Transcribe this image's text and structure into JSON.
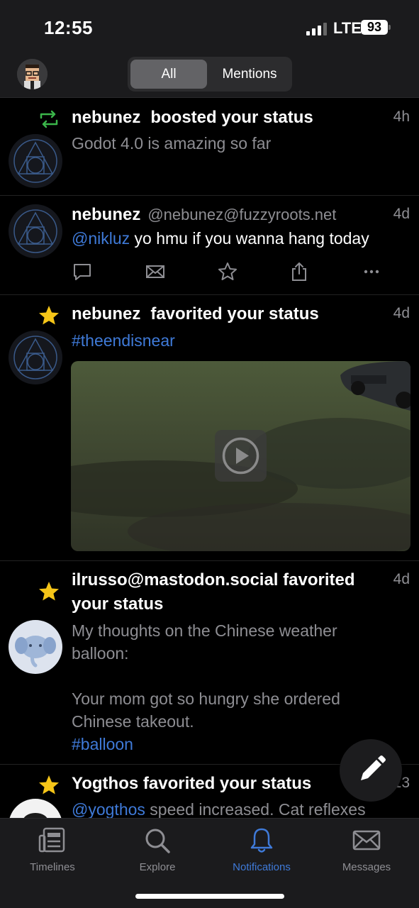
{
  "status_bar": {
    "time": "12:55",
    "network": "LTE",
    "battery": "93"
  },
  "header": {
    "tabs": [
      {
        "label": "All",
        "selected": true
      },
      {
        "label": "Mentions",
        "selected": false
      }
    ]
  },
  "notifications": [
    {
      "type": "boost",
      "type_icon": "boost-icon",
      "actor": "nebunez",
      "action": "boosted your status",
      "age": "4h",
      "text": "Godot 4.0 is amazing so far"
    },
    {
      "type": "mention",
      "actor": "nebunez",
      "handle": "@nebunez@fuzzyroots.net",
      "age": "4d",
      "mention": "@nikluz",
      "text": " yo hmu if you wanna hang today"
    },
    {
      "type": "favorite",
      "type_icon": "star-icon",
      "actor": "nebunez",
      "action": "favorited your status",
      "age": "4d",
      "hashtag": "#theendisnear",
      "media": "video"
    },
    {
      "type": "favorite",
      "type_icon": "star-icon",
      "actor": "ilrusso@mastodon.social favorited",
      "action_line2": "your status",
      "age": "4d",
      "text_line1": "My thoughts on the Chinese weather",
      "text_line2": "balloon:",
      "text_line3": "Your mom got so hungry she ordered",
      "text_line4": "Chinese takeout.",
      "hashtag": "#balloon"
    },
    {
      "type": "favorite",
      "type_icon": "star-icon",
      "actor": "Yogthos favorited your status",
      "age": "13",
      "mention": "@yogthos",
      "text": " speed increased. Cat reflexes"
    }
  ],
  "tab_bar": [
    {
      "label": "Timelines",
      "icon": "timelines-icon",
      "active": false
    },
    {
      "label": "Explore",
      "icon": "search-icon",
      "active": false
    },
    {
      "label": "Notifications",
      "icon": "bell-icon",
      "active": true
    },
    {
      "label": "Messages",
      "icon": "envelope-icon",
      "active": false
    }
  ],
  "colors": {
    "accent": "#3f7ad8",
    "boost": "#3bb54a",
    "star": "#f5c518",
    "background": "#000000"
  }
}
